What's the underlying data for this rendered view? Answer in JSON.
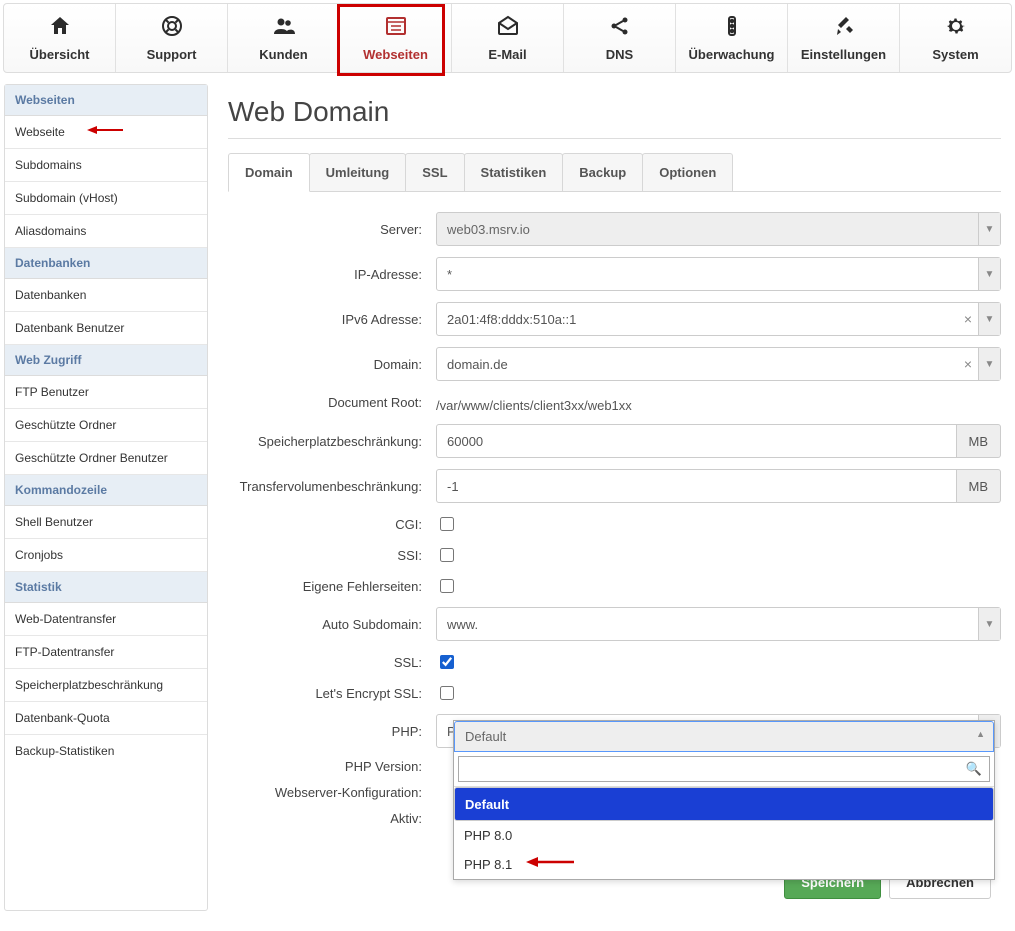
{
  "topnav": [
    {
      "label": "Übersicht",
      "icon": "home"
    },
    {
      "label": "Support",
      "icon": "lifebuoy"
    },
    {
      "label": "Kunden",
      "icon": "users"
    },
    {
      "label": "Webseiten",
      "icon": "website",
      "active": true
    },
    {
      "label": "E-Mail",
      "icon": "mail"
    },
    {
      "label": "DNS",
      "icon": "share"
    },
    {
      "label": "Überwachung",
      "icon": "monitor"
    },
    {
      "label": "Einstellungen",
      "icon": "tools"
    },
    {
      "label": "System",
      "icon": "gear"
    }
  ],
  "sidebar": [
    {
      "type": "head",
      "label": "Webseiten"
    },
    {
      "type": "item",
      "label": "Webseite",
      "arrow": true
    },
    {
      "type": "item",
      "label": "Subdomains"
    },
    {
      "type": "item",
      "label": "Subdomain (vHost)"
    },
    {
      "type": "item",
      "label": "Aliasdomains"
    },
    {
      "type": "head",
      "label": "Datenbanken"
    },
    {
      "type": "item",
      "label": "Datenbanken"
    },
    {
      "type": "item",
      "label": "Datenbank Benutzer"
    },
    {
      "type": "head",
      "label": "Web Zugriff"
    },
    {
      "type": "item",
      "label": "FTP Benutzer"
    },
    {
      "type": "item",
      "label": "Geschützte Ordner"
    },
    {
      "type": "item",
      "label": "Geschützte Ordner Benutzer"
    },
    {
      "type": "head",
      "label": "Kommandozeile"
    },
    {
      "type": "item",
      "label": "Shell Benutzer"
    },
    {
      "type": "item",
      "label": "Cronjobs"
    },
    {
      "type": "head",
      "label": "Statistik"
    },
    {
      "type": "item",
      "label": "Web-Datentransfer"
    },
    {
      "type": "item",
      "label": "FTP-Datentransfer"
    },
    {
      "type": "item",
      "label": "Speicherplatzbeschränkung"
    },
    {
      "type": "item",
      "label": "Datenbank-Quota"
    },
    {
      "type": "item",
      "label": "Backup-Statistiken"
    }
  ],
  "page": {
    "title": "Web Domain"
  },
  "tabs": [
    "Domain",
    "Umleitung",
    "SSL",
    "Statistiken",
    "Backup",
    "Optionen"
  ],
  "active_tab": 0,
  "form": {
    "server": {
      "label": "Server:",
      "value": "web03.msrv.io"
    },
    "ip": {
      "label": "IP-Adresse:",
      "value": "*"
    },
    "ipv6": {
      "label": "IPv6 Adresse:",
      "value": "2a01:4f8:dddx:510a::1"
    },
    "domain": {
      "label": "Domain:",
      "value": "domain.de"
    },
    "docroot": {
      "label": "Document Root:",
      "value": "/var/www/clients/client3xx/web1xx"
    },
    "quota": {
      "label": "Speicherplatzbeschränkung:",
      "value": "60000",
      "unit": "MB"
    },
    "traffic": {
      "label": "Transfervolumenbeschränkung:",
      "value": "-1",
      "unit": "MB"
    },
    "cgi": {
      "label": "CGI:",
      "checked": false
    },
    "ssi": {
      "label": "SSI:",
      "checked": false
    },
    "errpages": {
      "label": "Eigene Fehlerseiten:",
      "checked": false
    },
    "autosub": {
      "label": "Auto Subdomain:",
      "value": "www."
    },
    "ssl": {
      "label": "SSL:",
      "checked": true
    },
    "le": {
      "label": "Let's Encrypt SSL:",
      "checked": false
    },
    "php": {
      "label": "PHP:",
      "value": "PHP-FPM"
    },
    "phpver": {
      "label": "PHP Version:",
      "value": "Default",
      "options": [
        "Default",
        "PHP 8.0",
        "PHP 8.1"
      ],
      "selected": 0
    },
    "webconf": {
      "label": "Webserver-Konfiguration:"
    },
    "active": {
      "label": "Aktiv:"
    }
  },
  "buttons": {
    "save": "Speichern",
    "cancel": "Abbrechen"
  }
}
